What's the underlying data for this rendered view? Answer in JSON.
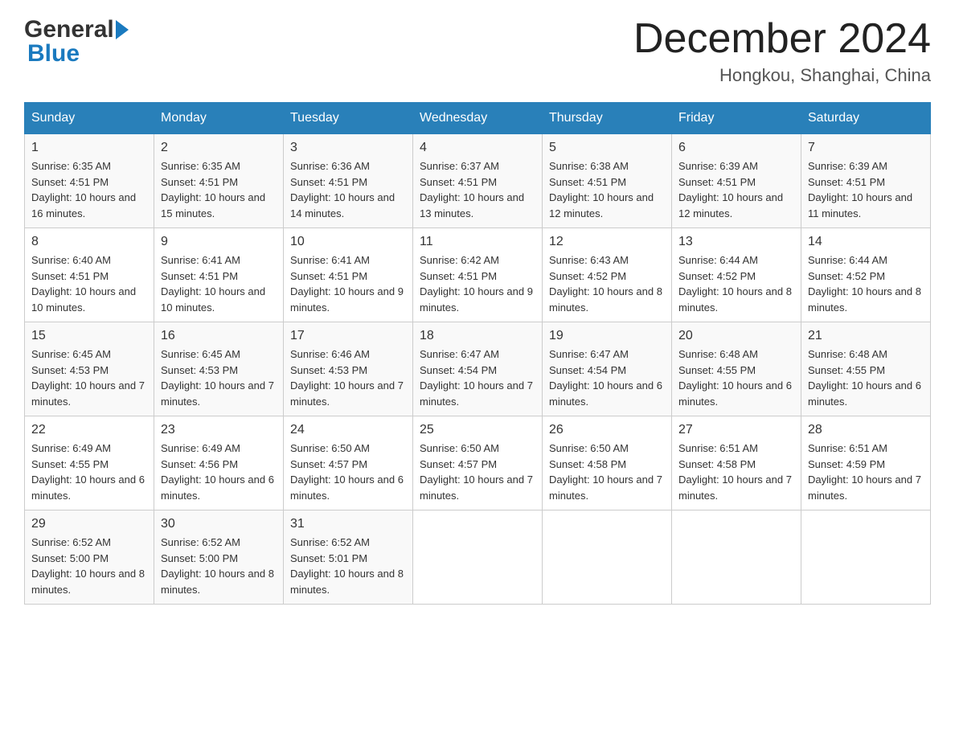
{
  "logo": {
    "general": "General",
    "blue": "Blue"
  },
  "title": {
    "month": "December 2024",
    "location": "Hongkou, Shanghai, China"
  },
  "weekdays": [
    "Sunday",
    "Monday",
    "Tuesday",
    "Wednesday",
    "Thursday",
    "Friday",
    "Saturday"
  ],
  "weeks": [
    [
      {
        "day": "1",
        "sunrise": "6:35 AM",
        "sunset": "4:51 PM",
        "daylight": "10 hours and 16 minutes."
      },
      {
        "day": "2",
        "sunrise": "6:35 AM",
        "sunset": "4:51 PM",
        "daylight": "10 hours and 15 minutes."
      },
      {
        "day": "3",
        "sunrise": "6:36 AM",
        "sunset": "4:51 PM",
        "daylight": "10 hours and 14 minutes."
      },
      {
        "day": "4",
        "sunrise": "6:37 AM",
        "sunset": "4:51 PM",
        "daylight": "10 hours and 13 minutes."
      },
      {
        "day": "5",
        "sunrise": "6:38 AM",
        "sunset": "4:51 PM",
        "daylight": "10 hours and 12 minutes."
      },
      {
        "day": "6",
        "sunrise": "6:39 AM",
        "sunset": "4:51 PM",
        "daylight": "10 hours and 12 minutes."
      },
      {
        "day": "7",
        "sunrise": "6:39 AM",
        "sunset": "4:51 PM",
        "daylight": "10 hours and 11 minutes."
      }
    ],
    [
      {
        "day": "8",
        "sunrise": "6:40 AM",
        "sunset": "4:51 PM",
        "daylight": "10 hours and 10 minutes."
      },
      {
        "day": "9",
        "sunrise": "6:41 AM",
        "sunset": "4:51 PM",
        "daylight": "10 hours and 10 minutes."
      },
      {
        "day": "10",
        "sunrise": "6:41 AM",
        "sunset": "4:51 PM",
        "daylight": "10 hours and 9 minutes."
      },
      {
        "day": "11",
        "sunrise": "6:42 AM",
        "sunset": "4:51 PM",
        "daylight": "10 hours and 9 minutes."
      },
      {
        "day": "12",
        "sunrise": "6:43 AM",
        "sunset": "4:52 PM",
        "daylight": "10 hours and 8 minutes."
      },
      {
        "day": "13",
        "sunrise": "6:44 AM",
        "sunset": "4:52 PM",
        "daylight": "10 hours and 8 minutes."
      },
      {
        "day": "14",
        "sunrise": "6:44 AM",
        "sunset": "4:52 PM",
        "daylight": "10 hours and 8 minutes."
      }
    ],
    [
      {
        "day": "15",
        "sunrise": "6:45 AM",
        "sunset": "4:53 PM",
        "daylight": "10 hours and 7 minutes."
      },
      {
        "day": "16",
        "sunrise": "6:45 AM",
        "sunset": "4:53 PM",
        "daylight": "10 hours and 7 minutes."
      },
      {
        "day": "17",
        "sunrise": "6:46 AM",
        "sunset": "4:53 PM",
        "daylight": "10 hours and 7 minutes."
      },
      {
        "day": "18",
        "sunrise": "6:47 AM",
        "sunset": "4:54 PM",
        "daylight": "10 hours and 7 minutes."
      },
      {
        "day": "19",
        "sunrise": "6:47 AM",
        "sunset": "4:54 PM",
        "daylight": "10 hours and 6 minutes."
      },
      {
        "day": "20",
        "sunrise": "6:48 AM",
        "sunset": "4:55 PM",
        "daylight": "10 hours and 6 minutes."
      },
      {
        "day": "21",
        "sunrise": "6:48 AM",
        "sunset": "4:55 PM",
        "daylight": "10 hours and 6 minutes."
      }
    ],
    [
      {
        "day": "22",
        "sunrise": "6:49 AM",
        "sunset": "4:55 PM",
        "daylight": "10 hours and 6 minutes."
      },
      {
        "day": "23",
        "sunrise": "6:49 AM",
        "sunset": "4:56 PM",
        "daylight": "10 hours and 6 minutes."
      },
      {
        "day": "24",
        "sunrise": "6:50 AM",
        "sunset": "4:57 PM",
        "daylight": "10 hours and 6 minutes."
      },
      {
        "day": "25",
        "sunrise": "6:50 AM",
        "sunset": "4:57 PM",
        "daylight": "10 hours and 7 minutes."
      },
      {
        "day": "26",
        "sunrise": "6:50 AM",
        "sunset": "4:58 PM",
        "daylight": "10 hours and 7 minutes."
      },
      {
        "day": "27",
        "sunrise": "6:51 AM",
        "sunset": "4:58 PM",
        "daylight": "10 hours and 7 minutes."
      },
      {
        "day": "28",
        "sunrise": "6:51 AM",
        "sunset": "4:59 PM",
        "daylight": "10 hours and 7 minutes."
      }
    ],
    [
      {
        "day": "29",
        "sunrise": "6:52 AM",
        "sunset": "5:00 PM",
        "daylight": "10 hours and 8 minutes."
      },
      {
        "day": "30",
        "sunrise": "6:52 AM",
        "sunset": "5:00 PM",
        "daylight": "10 hours and 8 minutes."
      },
      {
        "day": "31",
        "sunrise": "6:52 AM",
        "sunset": "5:01 PM",
        "daylight": "10 hours and 8 minutes."
      },
      null,
      null,
      null,
      null
    ]
  ],
  "labels": {
    "sunrise": "Sunrise:",
    "sunset": "Sunset:",
    "daylight": "Daylight:"
  }
}
